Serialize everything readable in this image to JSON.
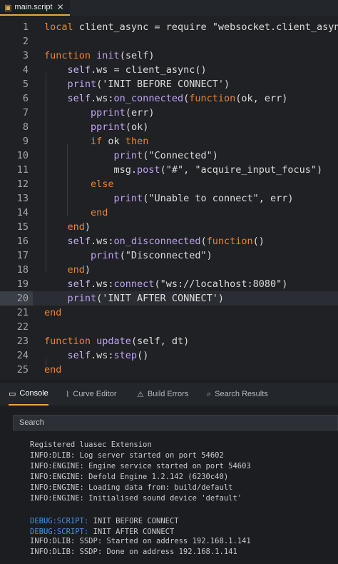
{
  "tab": {
    "icon": "script-file-icon",
    "label": "main.script",
    "close": "✕"
  },
  "code_lines": [
    {
      "n": "1",
      "html": "<span class='kw'>local</span> client_async = require \"websocket.client_async\""
    },
    {
      "n": "2",
      "html": ""
    },
    {
      "n": "3",
      "html": "<span class='kw'>function</span> <span class='fn'>init</span>(self)"
    },
    {
      "n": "4",
      "html": "    <span class='var'>self</span>.ws = client_async()"
    },
    {
      "n": "5",
      "html": "    <span class='fn'>print</span>('INIT BEFORE CONNECT')"
    },
    {
      "n": "6",
      "html": "    <span class='var'>self</span>.ws:<span class='fn'>on_connected</span>(<span class='kw'>function</span>(ok, err)"
    },
    {
      "n": "7",
      "html": "        <span class='fn'>pprint</span>(err)"
    },
    {
      "n": "8",
      "html": "        <span class='fn'>pprint</span>(ok)"
    },
    {
      "n": "9",
      "html": "        <span class='kw'>if</span> ok <span class='kw'>then</span>"
    },
    {
      "n": "10",
      "html": "            <span class='fn'>print</span>(\"Connected\")"
    },
    {
      "n": "11",
      "html": "            msg.<span class='fn'>post</span>(\"#\", \"acquire_input_focus\")"
    },
    {
      "n": "12",
      "html": "        <span class='kw'>else</span>"
    },
    {
      "n": "13",
      "html": "            <span class='fn'>print</span>(\"Unable to connect\", err)"
    },
    {
      "n": "14",
      "html": "        <span class='kw'>end</span>"
    },
    {
      "n": "15",
      "html": "    <span class='kw'>end</span>)"
    },
    {
      "n": "16",
      "html": "    <span class='var'>self</span>.ws:<span class='fn'>on_disconnected</span>(<span class='kw'>function</span>()"
    },
    {
      "n": "17",
      "html": "        <span class='fn'>print</span>(\"Disconnected\")"
    },
    {
      "n": "18",
      "html": "    <span class='kw'>end</span>)"
    },
    {
      "n": "19",
      "html": "    <span class='var'>self</span>.ws:<span class='fn'>connect</span>(\"ws://localhost:8080\")"
    },
    {
      "n": "20",
      "html": "    <span class='fn'>print</span>('INIT AFTER CONNECT')",
      "current": true
    },
    {
      "n": "21",
      "html": "<span class='kw'>end</span>"
    },
    {
      "n": "22",
      "html": ""
    },
    {
      "n": "23",
      "html": "<span class='kw'>function</span> <span class='fn'>update</span>(self, dt)"
    },
    {
      "n": "24",
      "html": "    <span class='var'>self</span>.ws:<span class='fn'>step</span>()"
    },
    {
      "n": "25",
      "html": "<span class='kw'>end</span>"
    }
  ],
  "panel_tabs": [
    {
      "icon": "console-icon",
      "glyph": "▭",
      "label": "Console",
      "active": true
    },
    {
      "icon": "curve-editor-icon",
      "glyph": "⌇",
      "label": "Curve Editor"
    },
    {
      "icon": "build-errors-icon",
      "glyph": "⚠",
      "label": "Build Errors"
    },
    {
      "icon": "search-results-icon",
      "glyph": "⌕",
      "label": "Search Results"
    }
  ],
  "console": {
    "search_placeholder": "Search",
    "logs": [
      {
        "text": "Registered luasec Extension"
      },
      {
        "text": "INFO:DLIB: Log server started on port 54602"
      },
      {
        "text": "INFO:ENGINE: Engine service started on port 54603"
      },
      {
        "text": "INFO:ENGINE: Defold Engine 1.2.142 (6230c40)"
      },
      {
        "text": "INFO:ENGINE: Loading data from: build/default"
      },
      {
        "text": "INFO:ENGINE: Initialised sound device 'default'"
      },
      {
        "text": ""
      },
      {
        "prefix": "DEBUG:SCRIPT:",
        "text": " INIT BEFORE CONNECT"
      },
      {
        "prefix": "DEBUG:SCRIPT:",
        "text": " INIT AFTER CONNECT"
      },
      {
        "text": "INFO:DLIB: SSDP: Started on address 192.168.1.141"
      },
      {
        "text": "INFO:DLIB: SSDP: Done on address 192.168.1.141"
      }
    ]
  },
  "colors": {
    "accent": "#e4a84b",
    "keyword": "#e8852f",
    "function": "#c0a3f0",
    "debug": "#4a90e2"
  }
}
